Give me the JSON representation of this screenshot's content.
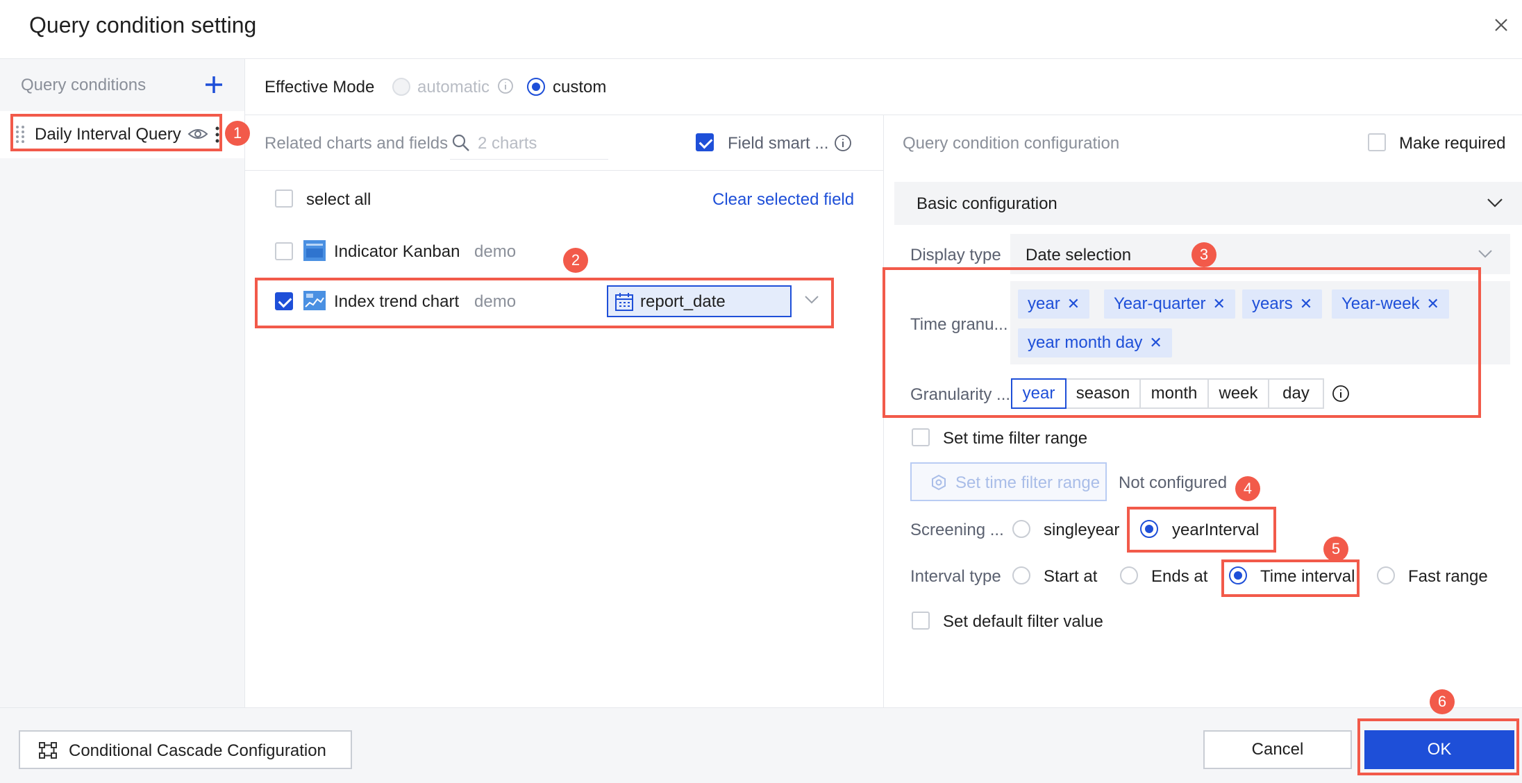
{
  "dialog": {
    "title": "Query condition setting"
  },
  "left": {
    "header": "Query conditions",
    "item": "Daily Interval Query"
  },
  "mode": {
    "label": "Effective Mode",
    "automatic": "automatic",
    "custom": "custom",
    "selected": "custom"
  },
  "related": {
    "header": "Related charts and fields",
    "search_placeholder": "2 charts",
    "smart_label": "Field smart ...",
    "select_all": "select all",
    "clear": "Clear selected field",
    "rows": [
      {
        "name": "Indicator Kanban",
        "source": "demo",
        "checked": false,
        "field": ""
      },
      {
        "name": "Index trend chart",
        "source": "demo",
        "checked": true,
        "field": "report_date"
      }
    ]
  },
  "config": {
    "header": "Query condition configuration",
    "make_required": "Make required",
    "section": "Basic configuration",
    "display_type_label": "Display type",
    "display_type_value": "Date selection",
    "time_gran_label": "Time granu...",
    "tags": [
      "year",
      "Year-quarter",
      "years",
      "Year-week",
      "year month day"
    ],
    "granularity_label": "Granularity ...",
    "granularity_options": [
      "year",
      "season",
      "month",
      "week",
      "day"
    ],
    "granularity_selected": "year",
    "set_range_label": "Set time filter range",
    "set_range_button": "Set time filter range",
    "not_configured": "Not configured",
    "screening_label": "Screening ...",
    "screening_options": [
      "singleyear",
      "yearInterval"
    ],
    "screening_selected": "yearInterval",
    "interval_label": "Interval type",
    "interval_options": [
      "Start at",
      "Ends at",
      "Time interval",
      "Fast range"
    ],
    "interval_selected": "Time interval",
    "default_value_label": "Set default filter value"
  },
  "footer": {
    "cascade": "Conditional Cascade Configuration",
    "cancel": "Cancel",
    "ok": "OK"
  },
  "annotations": [
    "1",
    "2",
    "3",
    "4",
    "5",
    "6"
  ],
  "colors": {
    "accent": "#1e4fd8",
    "highlight": "#f25a4a",
    "tag_bg": "#dfe8fb"
  }
}
